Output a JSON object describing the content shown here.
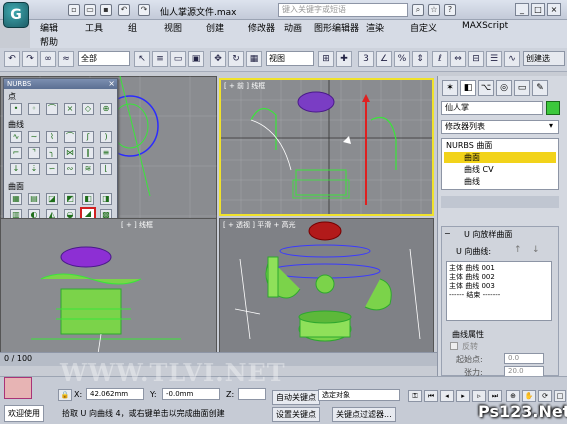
{
  "app": {
    "title": "仙人掌源文件.max",
    "search_placeholder": "键入关键字或短语"
  },
  "menu": {
    "items": [
      "编辑",
      "工具",
      "组",
      "视图",
      "创建",
      "修改器",
      "动画",
      "图形编辑器",
      "渲染",
      "自定义",
      "MAXScript",
      "帮助"
    ]
  },
  "toolbar": {
    "selection_filter": "全部",
    "ref_coord": "视图",
    "create_sel": "创建选"
  },
  "nurbs": {
    "title": "NURBS",
    "sections": [
      "点",
      "曲线",
      "曲面"
    ]
  },
  "viewports": {
    "top_right_label": "[ + 前 ] 线框",
    "bottom_right_label": "[ + 透视 ] 平滑 + 高光",
    "bottom_left_label": "[ + ] 线框"
  },
  "cmd": {
    "object_name": "仙人掌",
    "modifier_list": "修改器列表",
    "stack": [
      "NURBS 曲面",
      "曲面",
      "曲线 CV",
      "曲线"
    ],
    "rollout_title": "U 向放样曲面",
    "u_curves_label": "U 向曲线:",
    "u_curves": [
      "主体 曲线 001",
      "主体 曲线 002",
      "主体 曲线 003",
      "------ 结束 -------"
    ],
    "curve_props_title": "曲线属性",
    "reverse_label": "反转",
    "start_point_label": "起始点:",
    "start_point_value": "0.0",
    "tension_label": "张力:",
    "tension_value": "20.0"
  },
  "timeline": {
    "frame": "0 / 100"
  },
  "status": {
    "welcome": "欢迎使用",
    "prompt": "拾取 U 向曲线 4，或右键单击以完成曲面创建",
    "x_label": "X:",
    "x_value": "42.062mm",
    "y_label": "Y:",
    "y_value": "-0.0mm",
    "z_label": "Z:",
    "auto_key": "自动关键点",
    "set_key": "设置关键点",
    "selected": "选定对象",
    "key_filter": "关键点过滤器..."
  },
  "watermark": {
    "left": "WWW.TLVI.NET",
    "right": "Ps123.Net"
  }
}
